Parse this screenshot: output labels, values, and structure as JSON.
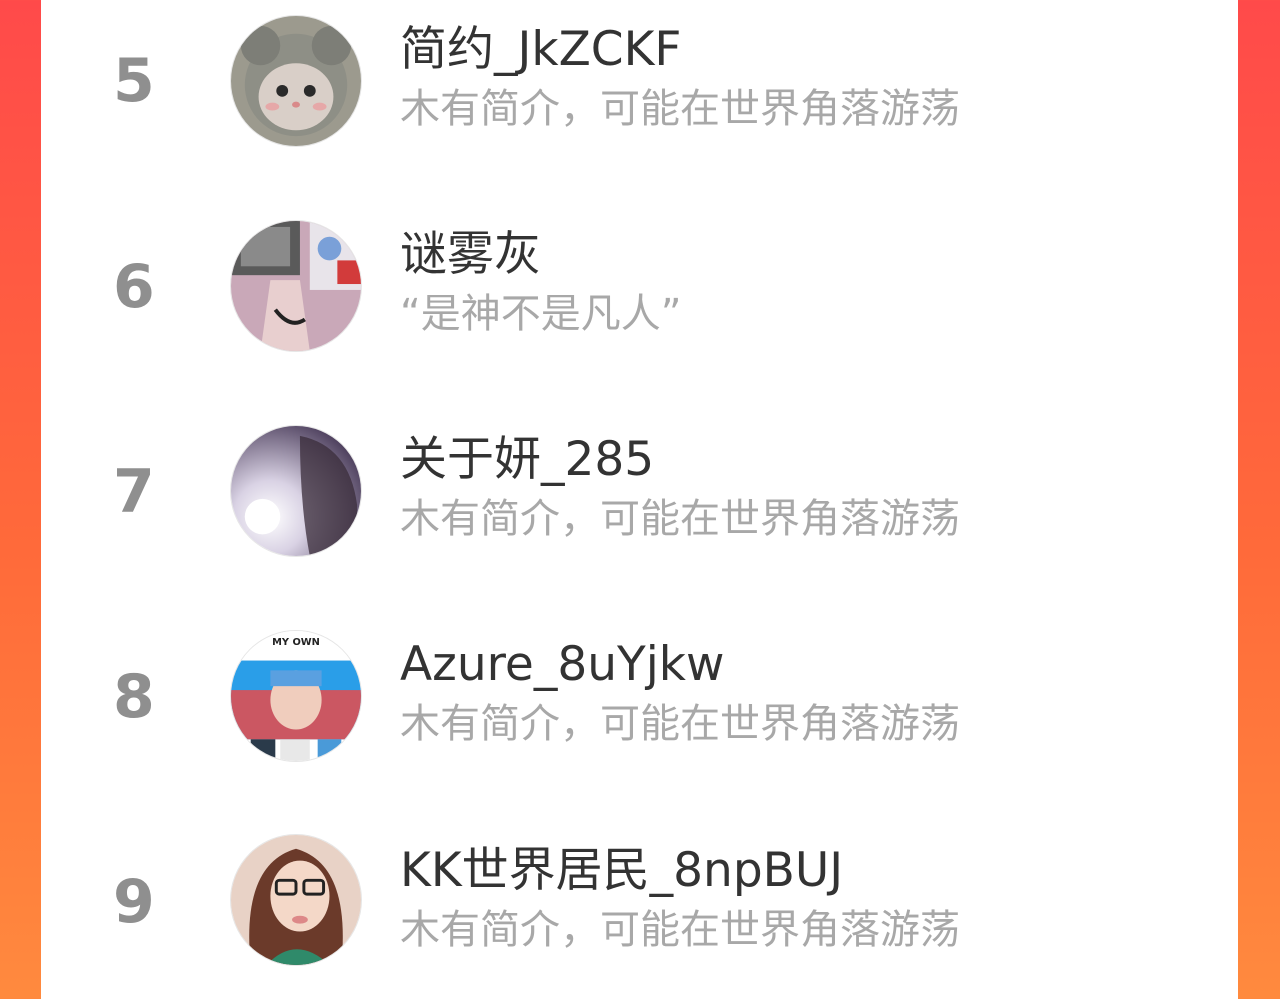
{
  "ranking": {
    "items": [
      {
        "rank": "5",
        "name": "简约_JkZCKF",
        "description": "木有简介，可能在世界角落游荡",
        "avatar_icon": "cat-avatar-icon"
      },
      {
        "rank": "6",
        "name": "谜雾灰",
        "description": "“是神不是凡人”",
        "avatar_icon": "photo-avatar-icon"
      },
      {
        "rank": "7",
        "name": "关于妍_285",
        "description": "木有简介，可能在世界角落游荡",
        "avatar_icon": "photo-avatar-icon"
      },
      {
        "rank": "8",
        "name": "Azure_8uYjkw",
        "description": "木有简介，可能在世界角落游荡",
        "avatar_icon": "photo-avatar-icon",
        "avatar_text": "MY OWN"
      },
      {
        "rank": "9",
        "name": "KK世界居民_8npBUJ",
        "description": "木有简介，可能在世界角落游荡",
        "avatar_icon": "photo-avatar-icon"
      }
    ]
  },
  "colors": {
    "background_gradient_top": "#ff4a4a",
    "background_gradient_bottom": "#ff8a3e",
    "rank_number": "#8f8f8f",
    "name_text": "#333333",
    "description_text": "#a8a8a8"
  }
}
